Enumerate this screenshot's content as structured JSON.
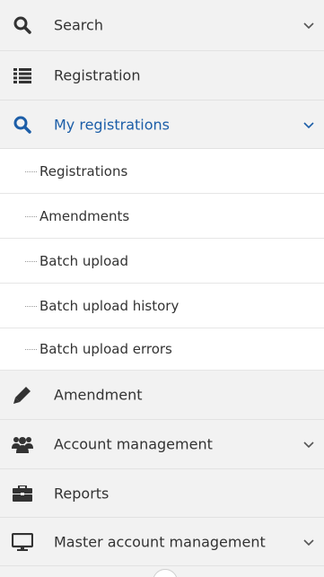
{
  "menu": {
    "search": {
      "label": "Search",
      "icon": "search-icon",
      "expandable": true
    },
    "registration": {
      "label": "Registration",
      "icon": "list-icon"
    },
    "my_registrations": {
      "label": "My registrations",
      "icon": "search-icon",
      "expanded": true,
      "items": [
        {
          "label": "Registrations"
        },
        {
          "label": "Amendments"
        },
        {
          "label": "Batch upload"
        },
        {
          "label": "Batch upload history"
        },
        {
          "label": "Batch upload errors"
        }
      ]
    },
    "amendment": {
      "label": "Amendment",
      "icon": "pencil-icon"
    },
    "account_management": {
      "label": "Account management",
      "icon": "users-icon",
      "expandable": true
    },
    "reports": {
      "label": "Reports",
      "icon": "briefcase-icon"
    },
    "master_account_management": {
      "label": "Master account management",
      "icon": "monitor-icon",
      "expandable": true
    }
  },
  "colors": {
    "active": "#1c5ea8",
    "text": "#333333",
    "background": "#f2f2f2",
    "submenu_background": "#ffffff"
  }
}
